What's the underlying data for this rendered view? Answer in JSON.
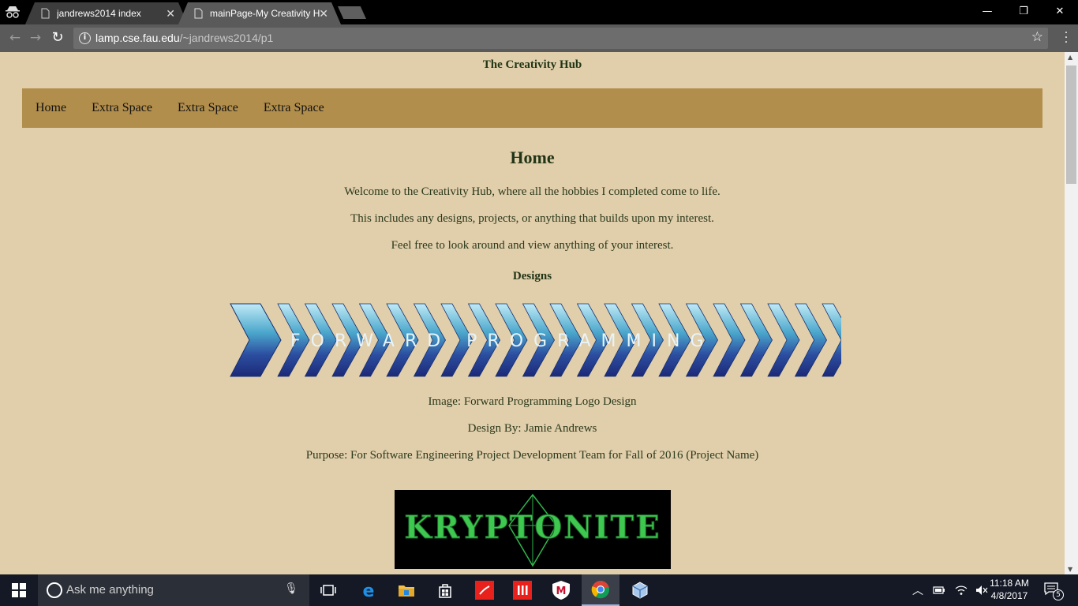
{
  "browser": {
    "tabs": [
      {
        "title": "jandrews2014 index"
      },
      {
        "title": "mainPage-My Creativity Hub"
      }
    ],
    "url_host": "lamp.cse.fau.edu",
    "url_path": "/~jandrews2014/p1"
  },
  "page": {
    "site_title": "The Creativity Hub",
    "nav": [
      "Home",
      "Extra Space",
      "Extra Space",
      "Extra Space"
    ],
    "heading": "Home",
    "intro": [
      "Welcome to the Creativity Hub, where all the hobbies I completed come to life.",
      "This includes any designs, projects, or anything that builds upon my interest.",
      "Feel free to look around and view anything of your interest."
    ],
    "designs_heading": "Designs",
    "image1": {
      "logo_text": "FORWARD PROGRAMMING",
      "caption": "Image: Forward Programming Logo Design",
      "credit": "Design By: Jamie Andrews",
      "purpose": "Purpose: For Software Engineering Project Development Team for Fall of 2016 (Project Name)"
    },
    "image2": {
      "logo_text": "KRYPTONITE"
    }
  },
  "taskbar": {
    "search_placeholder": "Ask me anything",
    "time": "11:18 AM",
    "date": "4/8/2017",
    "notification_count": "5"
  },
  "colors": {
    "page_bg": "#e1ceab",
    "nav_bg": "#b28e4c",
    "heading": "#213516"
  }
}
